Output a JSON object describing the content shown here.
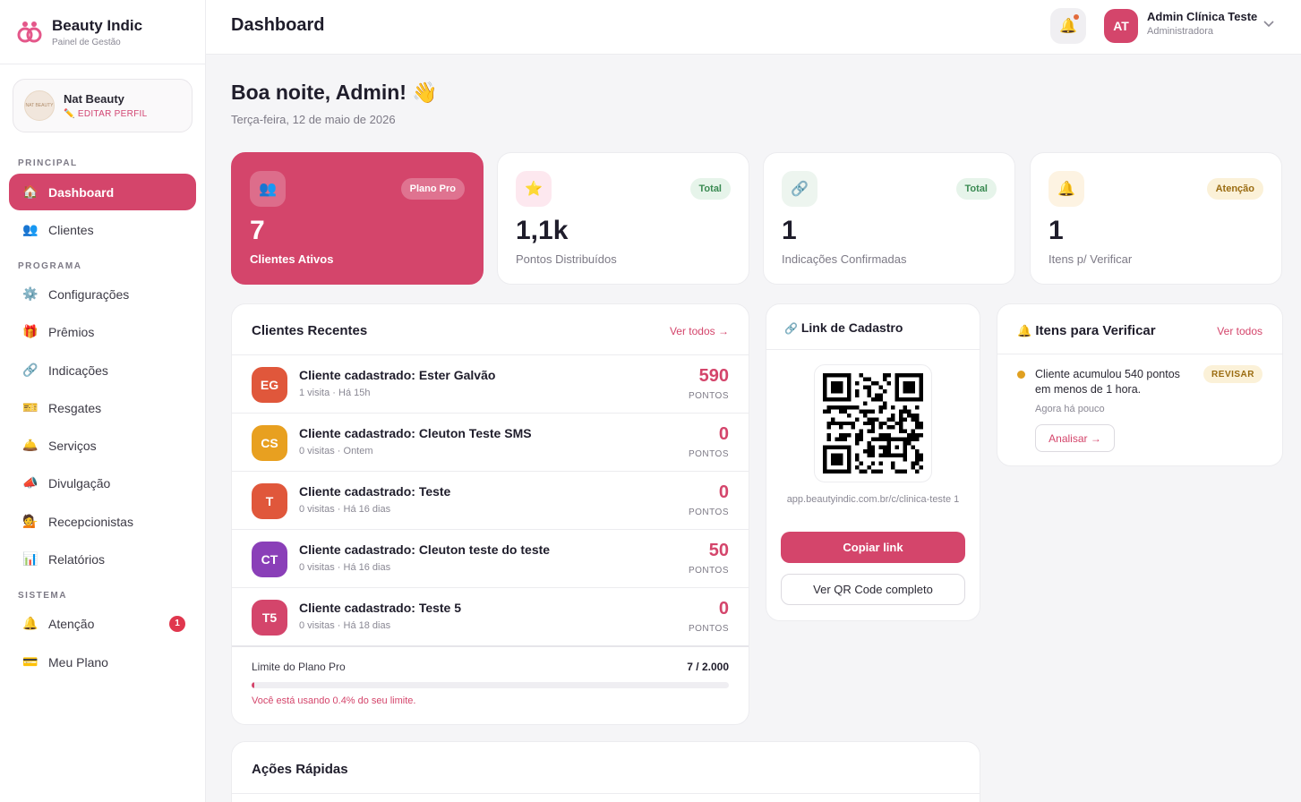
{
  "brand": {
    "name": "Beauty Indic",
    "subtitle": "Painel de Gestão"
  },
  "profile": {
    "name": "Nat Beauty",
    "edit_label": "EDITAR PERFIL",
    "avatar_text": "NAT BEAUTY"
  },
  "sidebar": {
    "sections": [
      "PRINCIPAL",
      "PROGRAMA",
      "SISTEMA"
    ],
    "items": [
      {
        "label": "Dashboard",
        "icon": "house-icon",
        "glyph": "🏠"
      },
      {
        "label": "Clientes",
        "icon": "users-icon",
        "glyph": "👥"
      },
      {
        "label": "Configurações",
        "icon": "gear-icon",
        "glyph": "⚙️"
      },
      {
        "label": "Prêmios",
        "icon": "gift-icon",
        "glyph": "🎁"
      },
      {
        "label": "Indicações",
        "icon": "link-icon",
        "glyph": "🔗"
      },
      {
        "label": "Resgates",
        "icon": "ticket-icon",
        "glyph": "🎫"
      },
      {
        "label": "Serviços",
        "icon": "service-bell-icon",
        "glyph": "🛎️"
      },
      {
        "label": "Divulgação",
        "icon": "megaphone-icon",
        "glyph": "📣"
      },
      {
        "label": "Recepcionistas",
        "icon": "receptionist-icon",
        "glyph": "💁"
      },
      {
        "label": "Relatórios",
        "icon": "bar-chart-icon",
        "glyph": "📊"
      },
      {
        "label": "Atenção",
        "icon": "bell-icon",
        "glyph": "🔔",
        "badge": "1"
      },
      {
        "label": "Meu Plano",
        "icon": "credit-card-icon",
        "glyph": "💳"
      }
    ]
  },
  "topbar": {
    "title": "Dashboard",
    "user": {
      "initials": "AT",
      "name": "Admin Clínica Teste",
      "role": "Administradora"
    }
  },
  "greeting": {
    "text": "Boa noite, Admin! 👋",
    "date": "Terça-feira, 12 de maio de 2026"
  },
  "stats": [
    {
      "value": "7",
      "label": "Clientes Ativos",
      "badge": "Plano Pro",
      "icon": "users-icon",
      "glyph": "👥"
    },
    {
      "value": "1,1k",
      "label": "Pontos Distribuídos",
      "badge": "Total",
      "icon": "star-icon",
      "glyph": "⭐"
    },
    {
      "value": "1",
      "label": "Indicações Confirmadas",
      "badge": "Total",
      "icon": "link-icon",
      "glyph": "🔗"
    },
    {
      "value": "1",
      "label": "Itens p/ Verificar",
      "badge": "Atenção",
      "icon": "bell-icon",
      "glyph": "🔔"
    }
  ],
  "colors": {
    "accent": "#d4456b",
    "success_badge_bg": "#e6f4ea",
    "success_badge_text": "#3a8a52",
    "warning_badge_bg": "#fbf1d8",
    "warning_badge_text": "#9a6b10"
  },
  "recent": {
    "title": "Clientes Recentes",
    "link": "Ver todos →",
    "points_label": "PONTOS",
    "rows": [
      {
        "initials": "EG",
        "color": "#e0573b",
        "title": "Cliente cadastrado: Ester Galvão",
        "meta": "1 visita · Há 15h",
        "points": "590"
      },
      {
        "initials": "CS",
        "color": "#e8a020",
        "title": "Cliente cadastrado: Cleuton Teste SMS",
        "meta": "0 visitas · Ontem",
        "points": "0"
      },
      {
        "initials": "T",
        "color": "#e0573b",
        "title": "Cliente cadastrado: Teste",
        "meta": "0 visitas · Há 16 dias",
        "points": "0"
      },
      {
        "initials": "CT",
        "color": "#8a3fb8",
        "title": "Cliente cadastrado: Cleuton teste do teste",
        "meta": "0 visitas · Há 16 dias",
        "points": "50"
      },
      {
        "initials": "T5",
        "color": "#d4456b",
        "title": "Cliente cadastrado: Teste 5",
        "meta": "0 visitas · Há 18 dias",
        "points": "0"
      }
    ],
    "limit": {
      "label": "Limite do Plano Pro",
      "value": "7 / 2.000",
      "percent": 0.4,
      "note": "Você está usando 0.4% do seu limite."
    }
  },
  "signup": {
    "title": "Link de Cadastro",
    "url": "app.beautyindic.com.br/c/clinica-teste 1",
    "copy_label": "Copiar link",
    "qr_label": "Ver QR Code completo"
  },
  "verify": {
    "title": "Itens para Verificar",
    "link": "Ver todos",
    "item": {
      "text": "Cliente acumulou 540 pontos em menos de 1 hora.",
      "time": "Agora há pouco",
      "badge": "REVISAR",
      "action": "Analisar →"
    }
  },
  "quick": {
    "title": "Ações Rápidas"
  }
}
